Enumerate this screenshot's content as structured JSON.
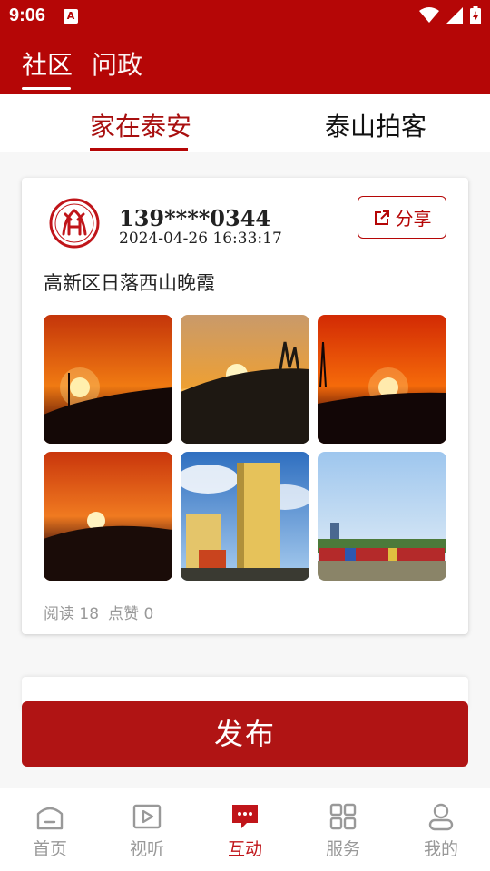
{
  "status_bar": {
    "time": "9:06",
    "notification_icon": "A"
  },
  "header": {
    "tabs": [
      {
        "label": "社区",
        "active": true
      },
      {
        "label": "问政",
        "active": false
      }
    ]
  },
  "subtabs": [
    {
      "label": "家在泰安",
      "active": true
    },
    {
      "label": "泰山拍客",
      "active": false
    }
  ],
  "post": {
    "username": "139****0344",
    "time": "2024-04-26 16:33:17",
    "share_label": "分享",
    "text": "高新区日落西山晚霞",
    "photos": [
      "sunset-1",
      "sunset-2",
      "sunset-3",
      "sunset-4",
      "buildings",
      "trucks-lot"
    ],
    "stats": {
      "reads": "阅读 18",
      "likes": "点赞 0"
    }
  },
  "publish_label": "发布",
  "bottom_nav": [
    {
      "label": "首页",
      "icon": "home-icon",
      "active": false
    },
    {
      "label": "视听",
      "icon": "play-icon",
      "active": false
    },
    {
      "label": "互动",
      "icon": "chat-icon",
      "active": true
    },
    {
      "label": "服务",
      "icon": "grid-icon",
      "active": false
    },
    {
      "label": "我的",
      "icon": "user-icon",
      "active": false
    }
  ],
  "colors": {
    "brand": "#b50606",
    "publish": "#b01414",
    "nav_active": "#c0151a"
  }
}
